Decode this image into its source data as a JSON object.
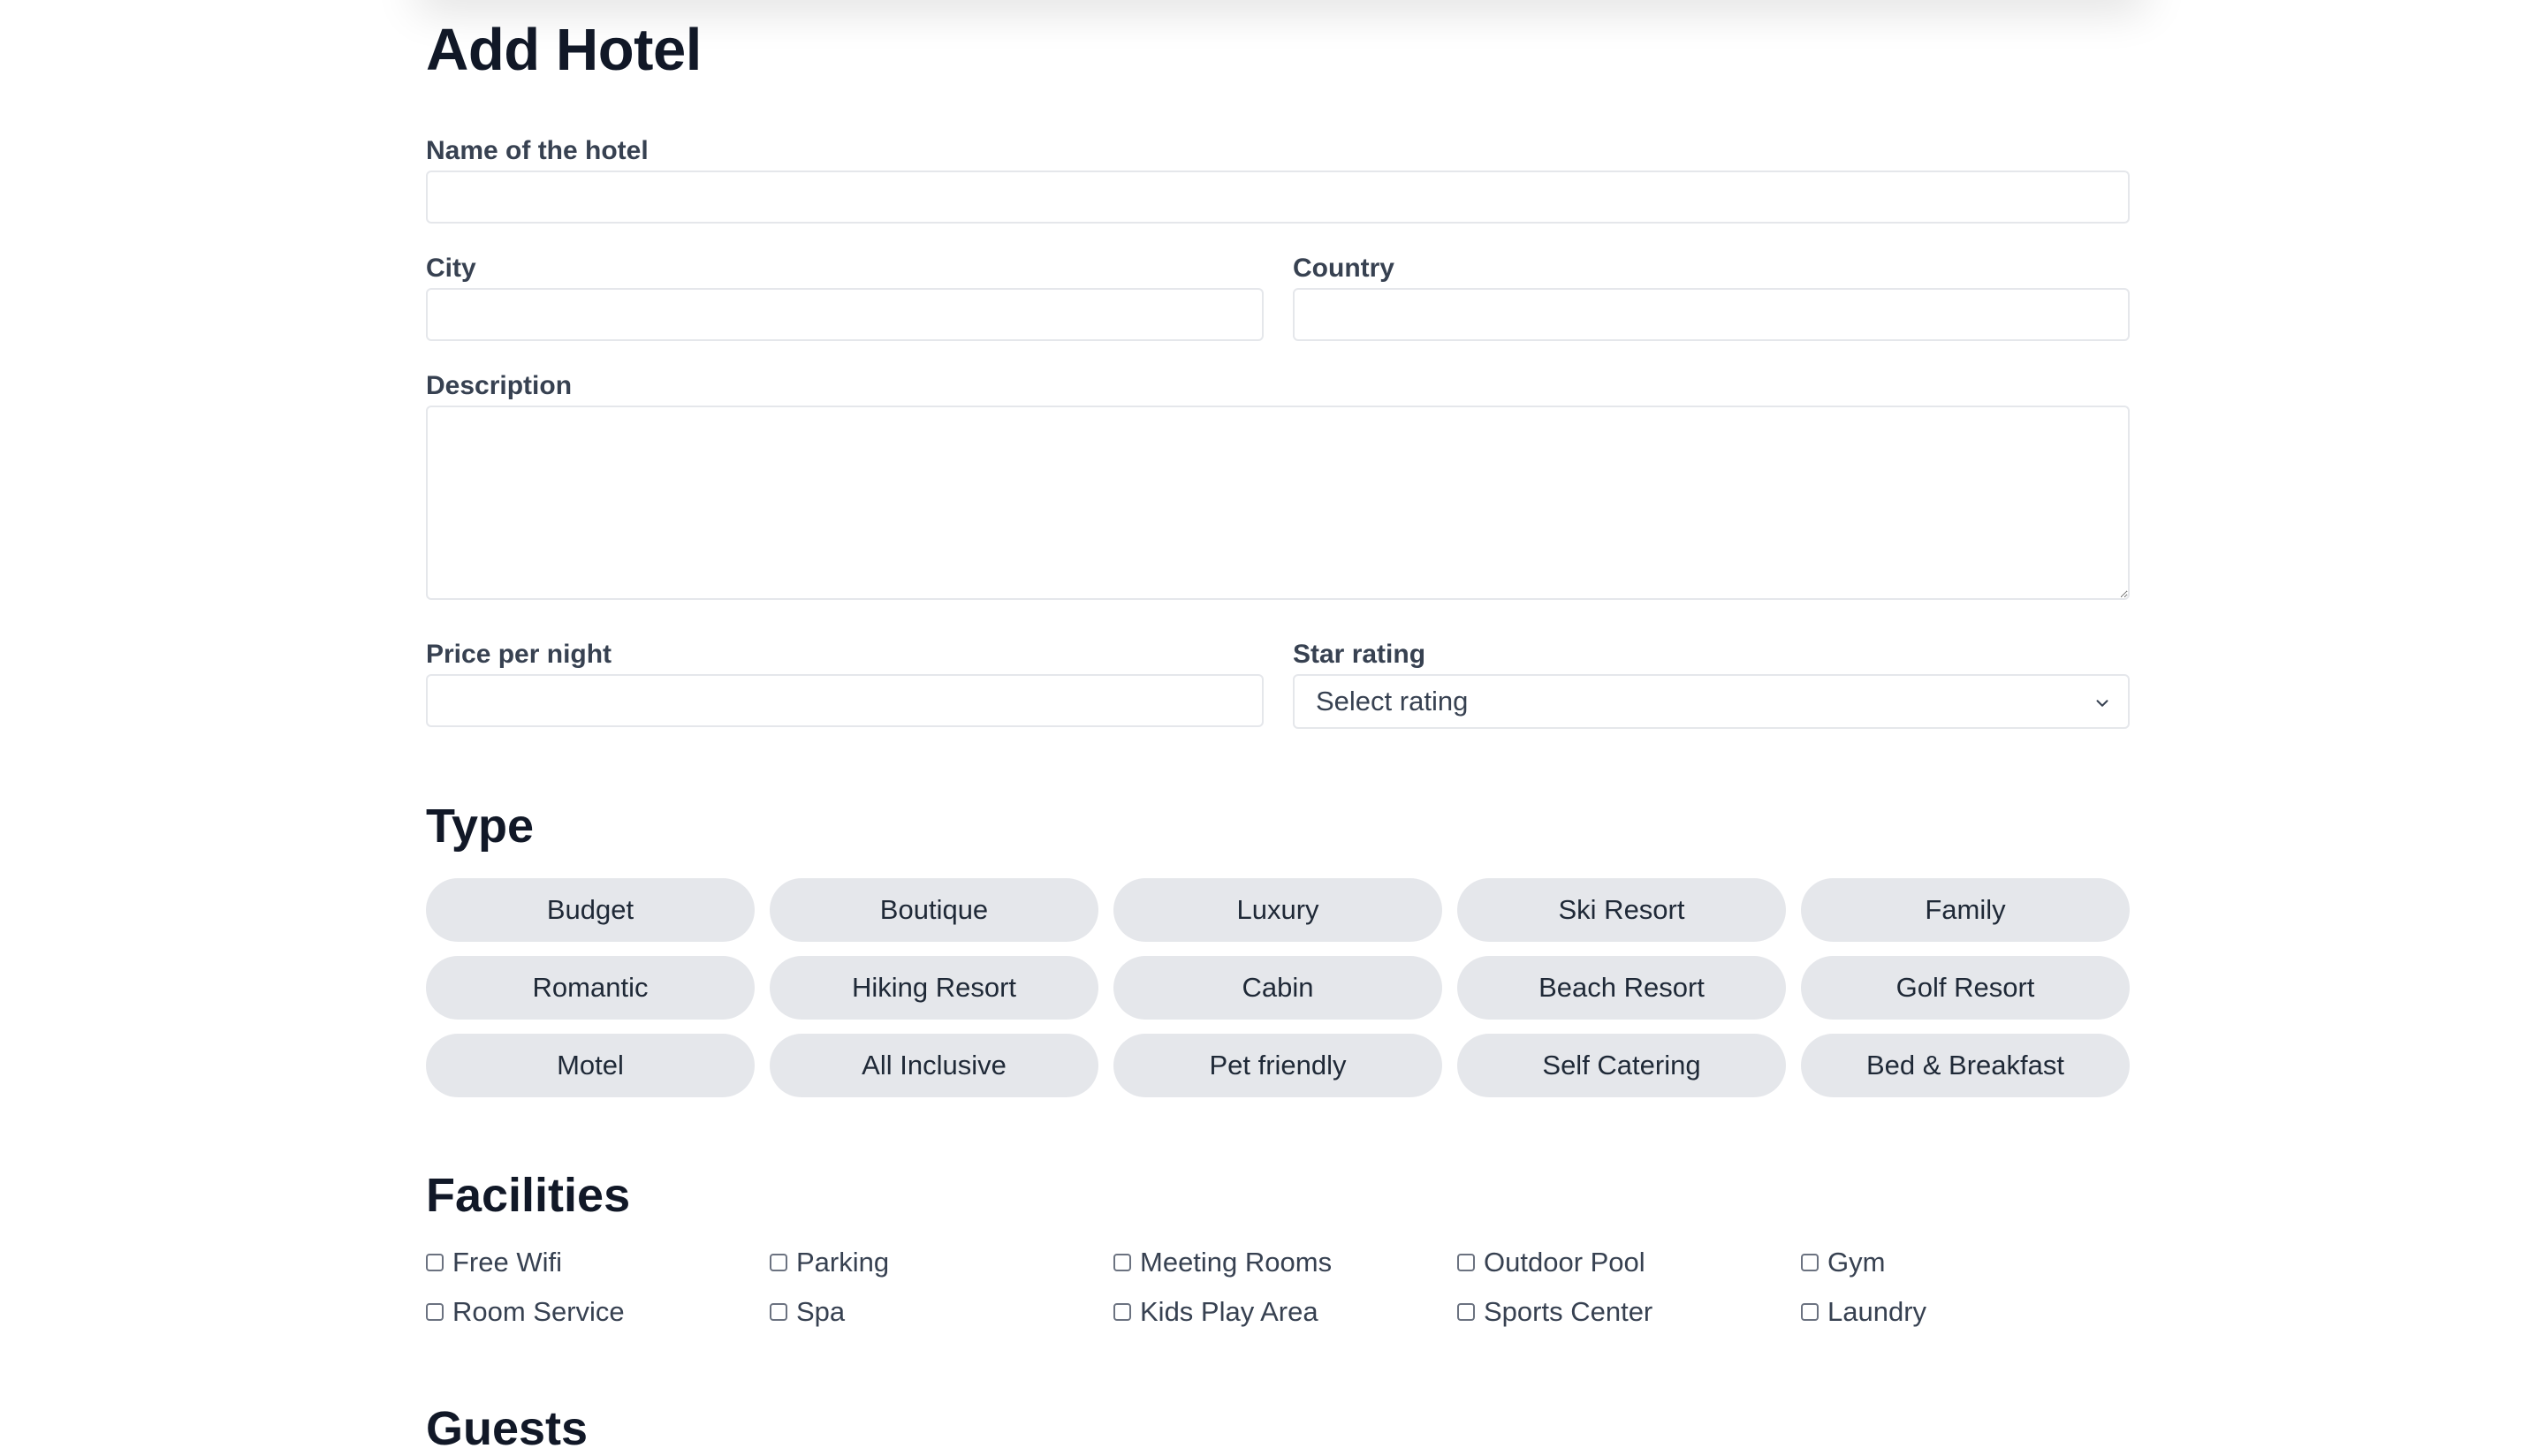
{
  "page": {
    "title": "Add Hotel"
  },
  "form": {
    "name_label": "Name of the hotel",
    "name_value": "",
    "city_label": "City",
    "city_value": "",
    "country_label": "Country",
    "country_value": "",
    "description_label": "Description",
    "description_value": "",
    "price_label": "Price per night",
    "price_value": "",
    "rating_label": "Star rating",
    "rating_selected": "Select rating"
  },
  "type": {
    "heading": "Type",
    "options": [
      "Budget",
      "Boutique",
      "Luxury",
      "Ski Resort",
      "Family",
      "Romantic",
      "Hiking Resort",
      "Cabin",
      "Beach Resort",
      "Golf Resort",
      "Motel",
      "All Inclusive",
      "Pet friendly",
      "Self Catering",
      "Bed & Breakfast"
    ]
  },
  "facilities": {
    "heading": "Facilities",
    "options": [
      "Free Wifi",
      "Parking",
      "Meeting Rooms",
      "Outdoor Pool",
      "Gym",
      "Room Service",
      "Spa",
      "Kids Play Area",
      "Sports Center",
      "Laundry"
    ]
  },
  "guests": {
    "heading": "Guests"
  },
  "colors": {
    "pill_bg": "#e5e7eb",
    "border": "#e5e7eb",
    "heading": "#111827",
    "label": "#374151"
  },
  "icons": {
    "select_chevron": "chevron-down-icon",
    "checkbox": "checkbox-icon"
  }
}
